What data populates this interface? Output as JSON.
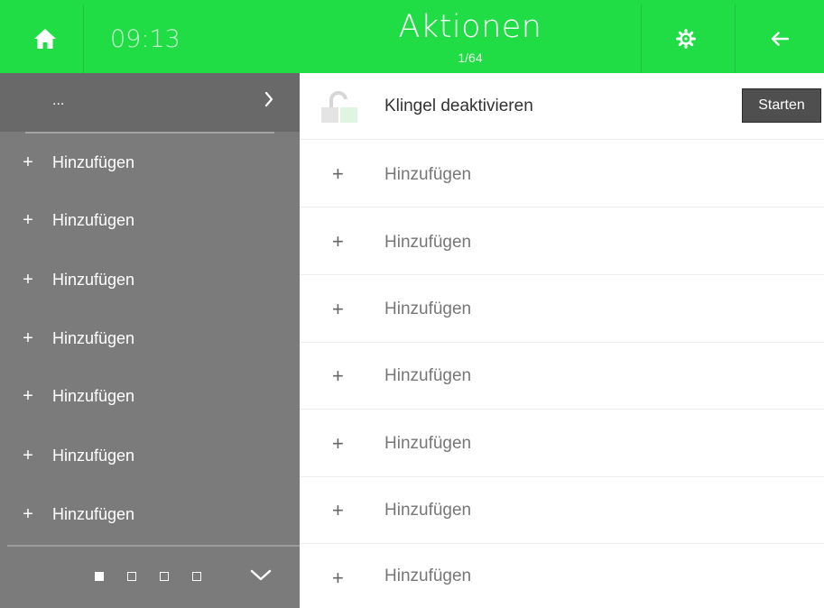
{
  "header": {
    "time": "09:13",
    "title": "Aktionen",
    "subtitle": "1/64",
    "icons": {
      "home": "home-icon",
      "settings": "settings-gear-icon",
      "back": "arrow-left-icon"
    },
    "colors": {
      "bar": "#20dd45",
      "text": "#ffffff"
    }
  },
  "sidebar": {
    "top_label": "...",
    "items": [
      {
        "label": "Hinzufügen"
      },
      {
        "label": "Hinzufügen"
      },
      {
        "label": "Hinzufügen"
      },
      {
        "label": "Hinzufügen"
      },
      {
        "label": "Hinzufügen"
      },
      {
        "label": "Hinzufügen"
      },
      {
        "label": "Hinzufügen"
      }
    ],
    "pagination": {
      "pages": 4,
      "active_page": 1
    },
    "colors": {
      "background": "#7b7b7b",
      "header": "#696969"
    }
  },
  "main": {
    "first_row": {
      "label": "Klingel deaktivieren",
      "button_label": "Starten",
      "icon": "door-unlock-icon"
    },
    "add_rows": [
      {
        "label": "Hinzufügen"
      },
      {
        "label": "Hinzufügen"
      },
      {
        "label": "Hinzufügen"
      },
      {
        "label": "Hinzufügen"
      },
      {
        "label": "Hinzufügen"
      },
      {
        "label": "Hinzufügen"
      },
      {
        "label": "Hinzufügen"
      }
    ]
  }
}
